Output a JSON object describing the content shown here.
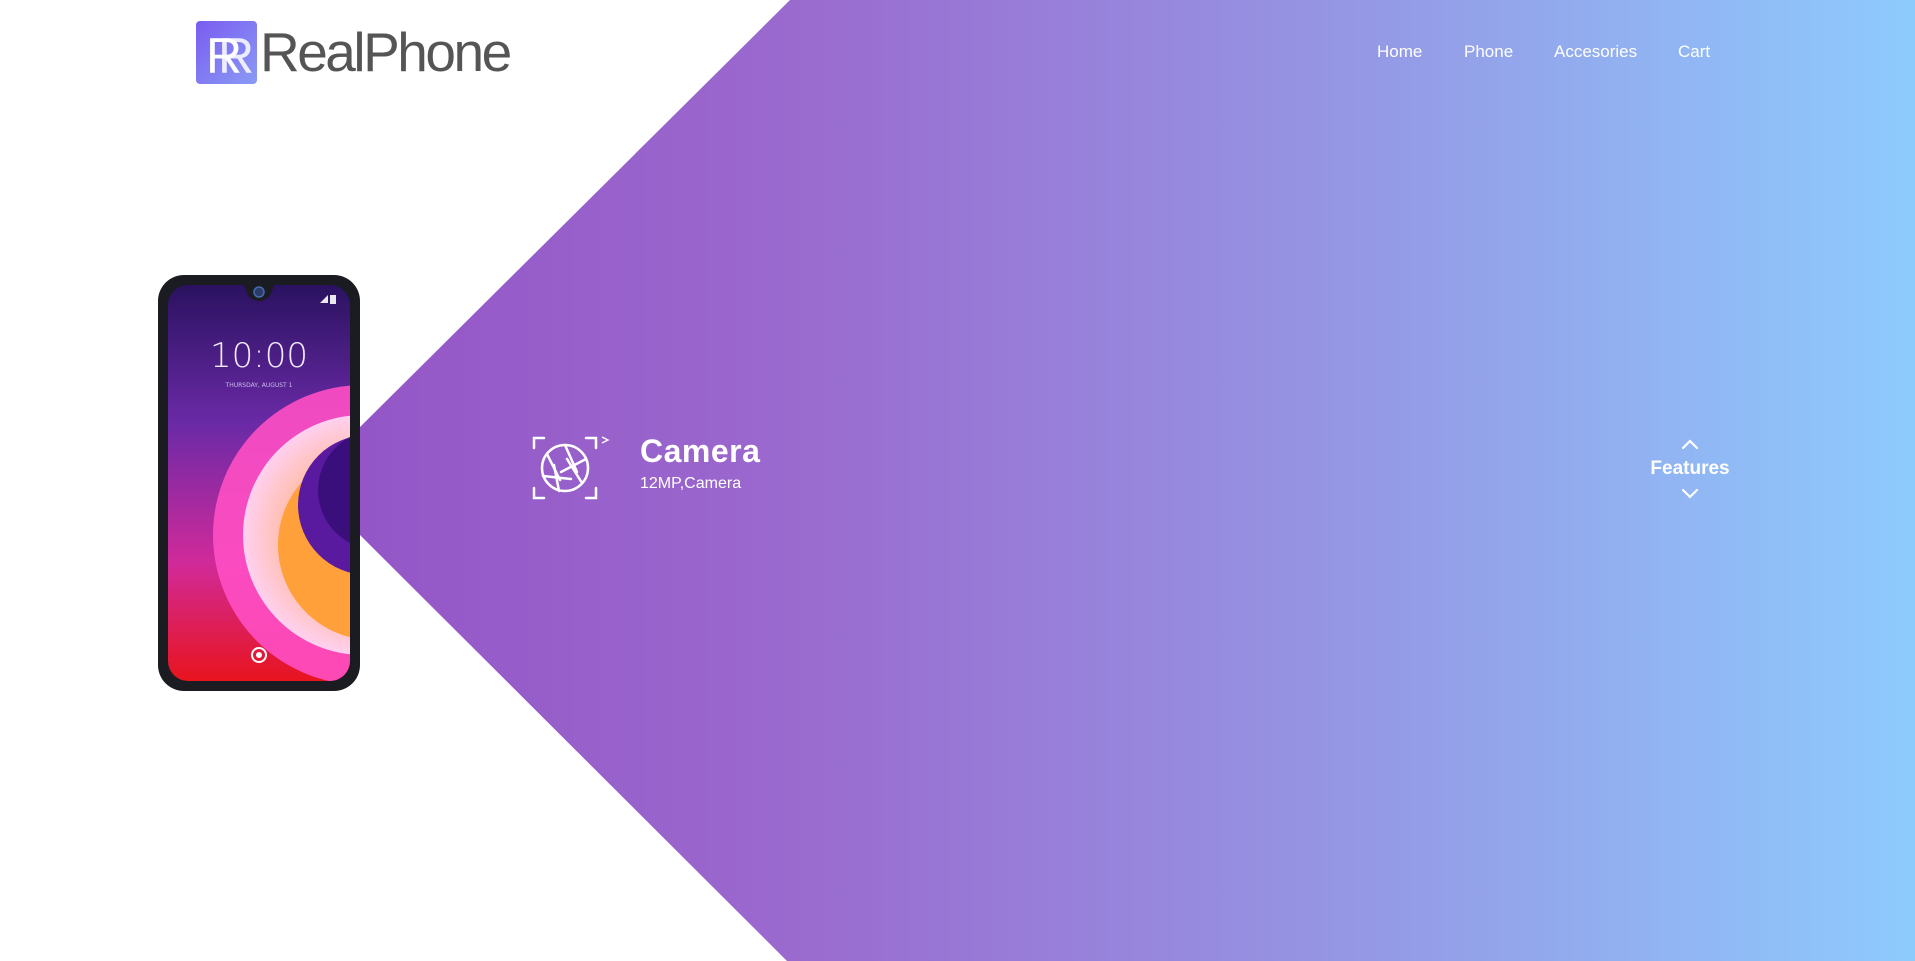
{
  "brand": {
    "name": "RealPhone",
    "mark": "R"
  },
  "nav": {
    "items": [
      {
        "label": "Home"
      },
      {
        "label": "Phone"
      },
      {
        "label": "Accesories"
      },
      {
        "label": "Cart"
      }
    ]
  },
  "phone_screen": {
    "time": "10:00",
    "date": "THURSDAY, AUGUST 1"
  },
  "feature": {
    "icon": "camera-aperture-icon",
    "title": "Camera",
    "subtitle": "12MP,Camera"
  },
  "switcher": {
    "label": "Features",
    "up_icon": "chevron-up-icon",
    "down_icon": "chevron-down-icon"
  },
  "colors": {
    "gradient_start": "#8f46c0",
    "gradient_end": "#8ecbfd",
    "logo_text": "#555555",
    "text_on_gradient": "#ffffff"
  }
}
